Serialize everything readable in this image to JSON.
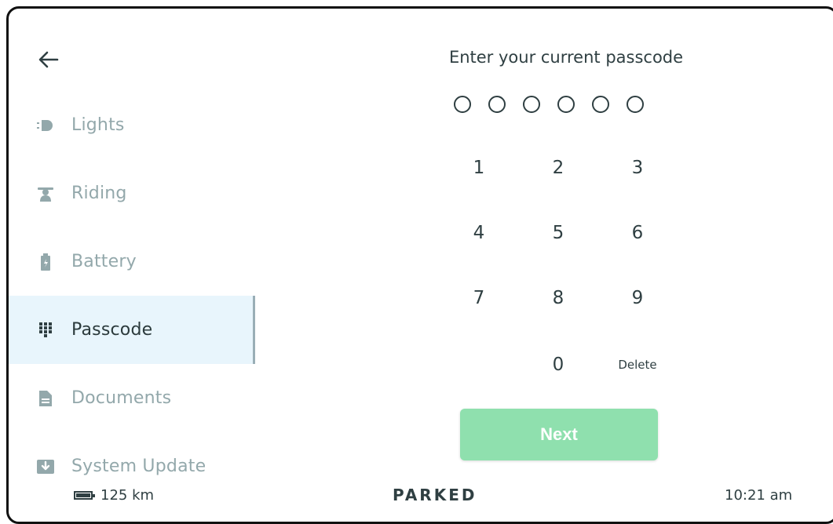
{
  "header": {
    "title": "Enter your current passcode"
  },
  "sidebar": {
    "items": [
      {
        "label": "Lights",
        "icon": "headlight-icon"
      },
      {
        "label": "Riding",
        "icon": "rider-icon"
      },
      {
        "label": "Battery",
        "icon": "battery-icon"
      },
      {
        "label": "Passcode",
        "icon": "keypad-icon",
        "active": true
      },
      {
        "label": "Documents",
        "icon": "document-icon"
      },
      {
        "label": "System Update",
        "icon": "download-icon"
      }
    ]
  },
  "passcode": {
    "length": 6,
    "entered": 0
  },
  "keypad": {
    "keys": [
      "1",
      "2",
      "3",
      "4",
      "5",
      "6",
      "7",
      "8",
      "9",
      "0"
    ],
    "delete_label": "Delete"
  },
  "actions": {
    "next_label": "Next"
  },
  "status_bar": {
    "range": "125 km",
    "state": "PARKED",
    "time": "10:21 am"
  },
  "colors": {
    "accent_green": "#8fe0ae",
    "active_bg": "#e8f5fc",
    "muted_text": "#93a8ab",
    "dark_text": "#2f3f42"
  }
}
